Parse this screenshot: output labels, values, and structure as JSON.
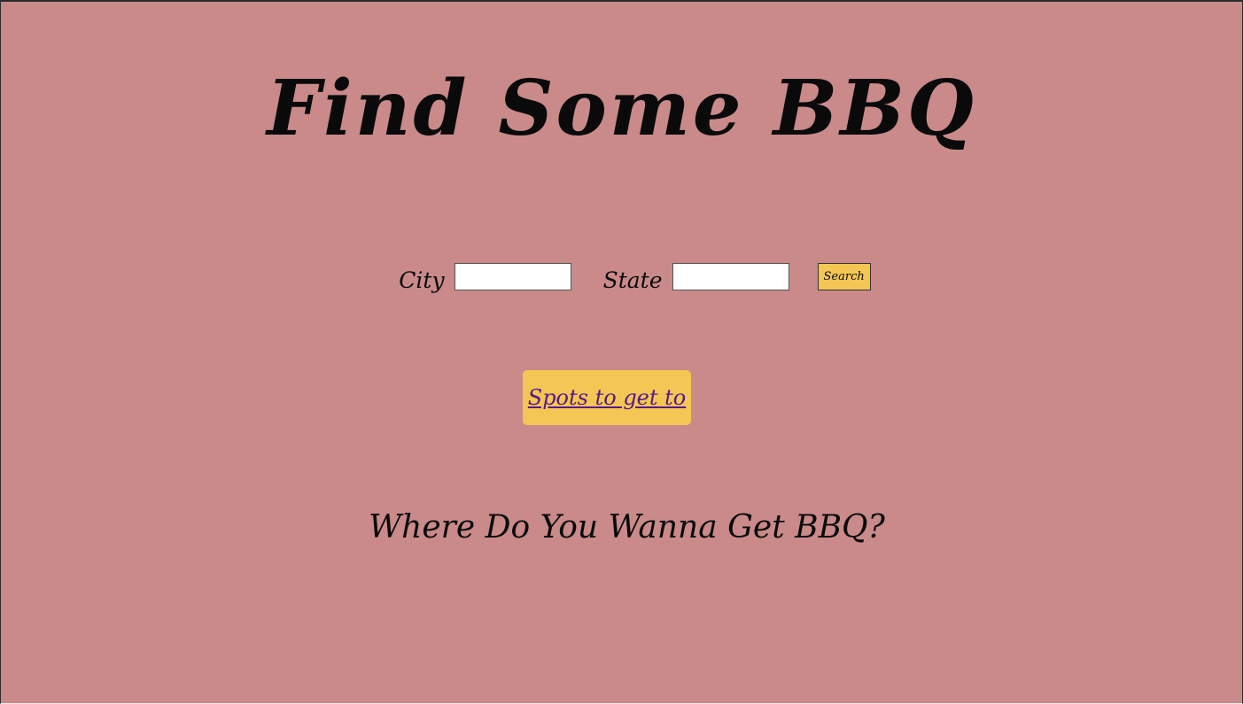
{
  "header": {
    "title": "Find Some BBQ"
  },
  "search": {
    "city_label": "City",
    "city_value": "",
    "state_label": "State",
    "state_value": "",
    "button_label": "Search"
  },
  "nav": {
    "spots_label": "Spots to get to"
  },
  "main": {
    "prompt": "Where Do You Wanna Get BBQ?"
  },
  "colors": {
    "background": "#ca8a8a",
    "accent": "#f4c653",
    "link": "#551a8b"
  }
}
